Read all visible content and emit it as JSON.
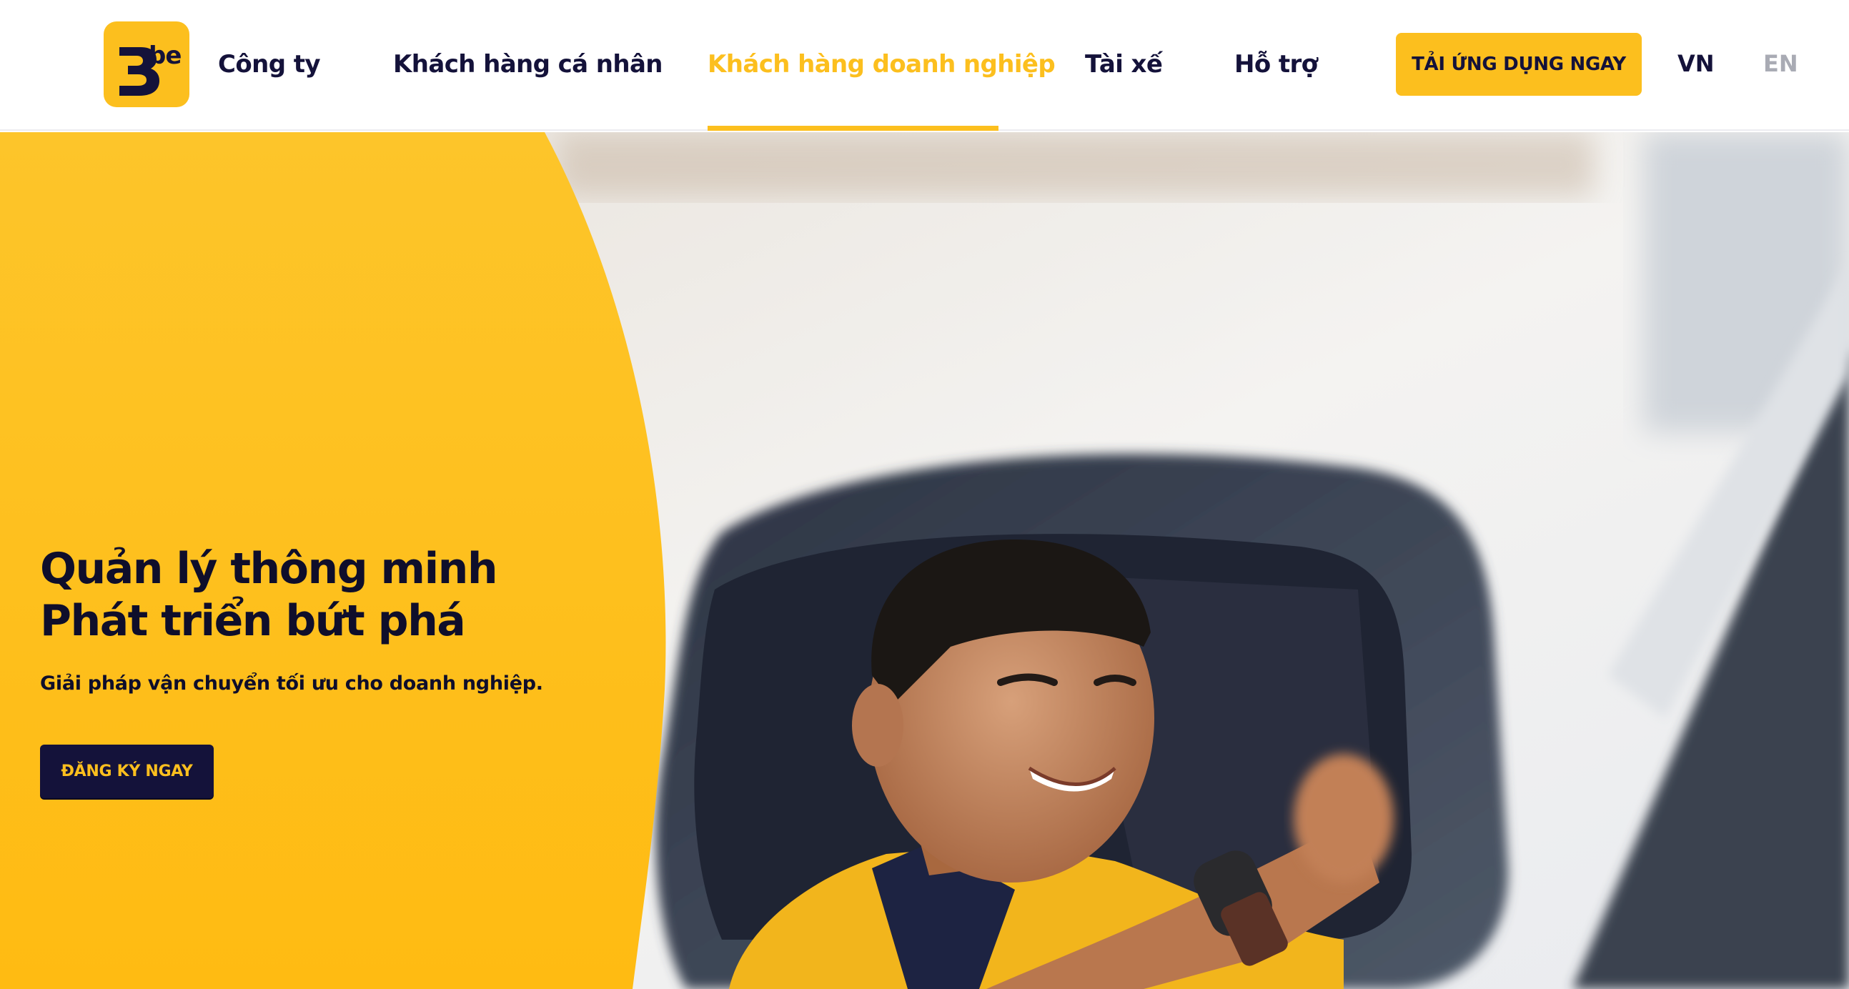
{
  "brand": {
    "name": "be",
    "logo_icon": "be-logo-icon",
    "accent": "#fcbf1e",
    "dark": "#14123a"
  },
  "nav": {
    "items": [
      {
        "label": "Công ty",
        "active": false
      },
      {
        "label": "Khách hàng cá nhân",
        "active": false
      },
      {
        "label": "Khách hàng doanh nghiệp",
        "active": true
      },
      {
        "label": "Tài xế",
        "active": false
      },
      {
        "label": "Hỗ trợ",
        "active": false
      }
    ],
    "cta_label": "TẢI ỨNG DỤNG NGAY",
    "languages": [
      {
        "code": "VN",
        "selected": true
      },
      {
        "code": "EN",
        "selected": false
      }
    ]
  },
  "hero": {
    "title_line1": "Quản lý thông minh",
    "title_line2": "Phát triển bứt phá",
    "subtitle": "Giải pháp vận chuyển tối ưu cho doanh nghiệp.",
    "cta_label": "ĐĂNG KÝ NGAY",
    "image": "driver-in-side-mirror-photo"
  }
}
